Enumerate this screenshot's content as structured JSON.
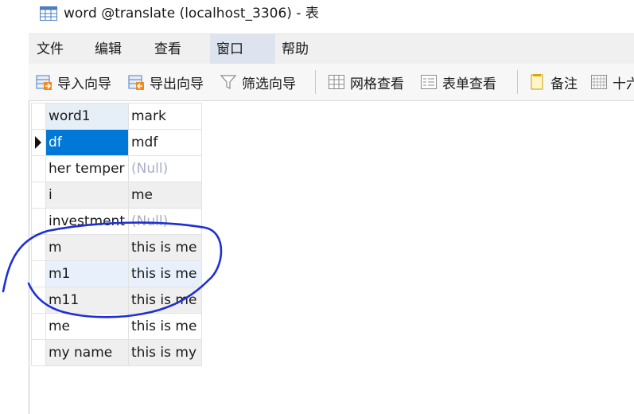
{
  "window": {
    "title": "word @translate (localhost_3306) - 表"
  },
  "menu": {
    "items": [
      "文件",
      "编辑",
      "查看",
      "窗口",
      "帮助"
    ],
    "active": "窗口"
  },
  "toolbar": {
    "import_label": "导入向导",
    "export_label": "导出向导",
    "filter_label": "筛选向导",
    "grid_view_label": "网格查看",
    "form_view_label": "表单查看",
    "memo_label": "备注",
    "hex_label": "十六"
  },
  "grid": {
    "columns": [
      "word1",
      "mark"
    ],
    "rows": [
      {
        "word1": "df",
        "mark": "mdf"
      },
      {
        "word1": "her temper",
        "mark": "(Null)"
      },
      {
        "word1": "i",
        "mark": "me"
      },
      {
        "word1": "investment",
        "mark": "(Null)"
      },
      {
        "word1": "m",
        "mark": "this is me"
      },
      {
        "word1": "m1",
        "mark": "this is me"
      },
      {
        "word1": "m11",
        "mark": "this is me"
      },
      {
        "word1": "me",
        "mark": "this is me"
      },
      {
        "word1": "my name",
        "mark": "this is my"
      }
    ],
    "selected_row": 0,
    "null_text": "(Null)"
  },
  "annotation": {
    "color": "#1f2fd6",
    "icon": "hand-drawn-circle"
  }
}
